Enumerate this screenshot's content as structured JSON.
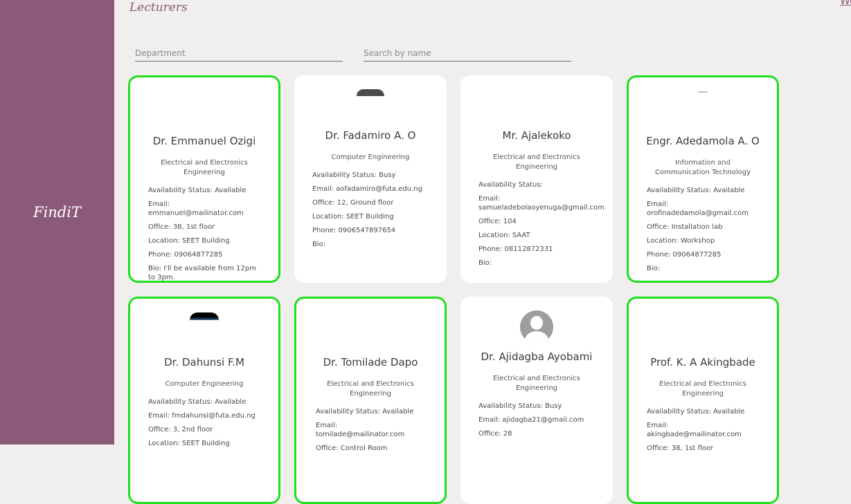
{
  "app": {
    "logo": "FindiT",
    "top_link": "Wo"
  },
  "page": {
    "title": "Lecturers"
  },
  "filters": {
    "department_placeholder": "Department",
    "search_placeholder": "Search by name"
  },
  "lecturers": [
    {
      "name": "Dr. Emmanuel Ozigi",
      "department": "Electrical and Electronics Engineering",
      "availability": "Availability Status: Available",
      "email": "Email: emmanuel@mailinator.com",
      "office": "Office: 38, 1st floor",
      "location": "Location: SEET Building",
      "phone": "Phone: 09064877285",
      "bio": "Bio: I'll be available from 12pm to 3pm."
    },
    {
      "name": "Dr. Fadamiro A. O",
      "department": "Computer Engineering",
      "availability": "Availability Status: Busy",
      "email": "Email: aofadamiro@futa.edu.ng",
      "office": "Office: 12, Ground floor",
      "location": "Location: SEET Building",
      "phone": "Phone: 0906547897654",
      "bio": "Bio:"
    },
    {
      "name": "Mr. Ajalekoko",
      "department": "Electrical and Electronics Engineering",
      "availability": "Availability Status:",
      "email": "Email: samueladebolaoyenuga@gmail.com",
      "office": "Office: 104",
      "location": "Location: SAAT",
      "phone": "Phone: 08112872331",
      "bio": "Bio:"
    },
    {
      "name": "Engr. Adedamola A. O",
      "department": "Information and Communication Technology",
      "availability": "Availability Status: Available",
      "email": "Email: orofinadedamola@gmail.com",
      "office": "Office: Installation lab",
      "location": "Location: Workshop",
      "phone": "Phone: 09064877285",
      "bio": "Bio:"
    },
    {
      "name": "Dr. Dahunsi F.M",
      "department": "Computer Engineering",
      "availability": "Availability Status: Available",
      "email": "Email: fmdahunsi@futa.edu.ng",
      "office": "Office: 3, 2nd floor",
      "location": "Location: SEET Building"
    },
    {
      "name": "Dr. Tomilade Dapo",
      "department": "Electrical and Electronics Engineering",
      "availability": "Availability Status: Available",
      "email": "Email: tomilade@mailinator.com",
      "office": "Office: Control Room"
    },
    {
      "name": "Dr. Ajidagba Ayobami",
      "department": "Electrical and Electronics Engineering",
      "availability": "Availability Status: Busy",
      "email": "Email: ajidagba21@gmail.com",
      "office": "Office: 28"
    },
    {
      "name": "Prof. K. A Akingbade",
      "department": "Electrical and Electronics Engineering",
      "availability": "Availability Status: Available",
      "email": "Email: akingbade@mailinator.com",
      "office": "Office: 38, 1st floor"
    }
  ]
}
